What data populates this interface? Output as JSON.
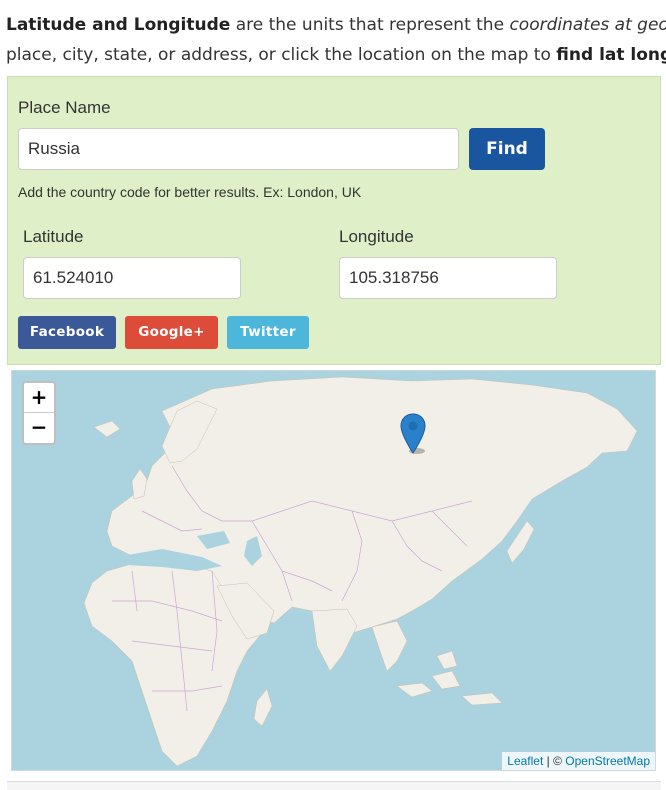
{
  "intro": {
    "line1_bold": "Latitude and Longitude",
    "line1_text": " are the units that represent the ",
    "line1_italic": "coordinates at geographic",
    "line2_text": "place, city, state, or address, or click the location on the map to ",
    "line2_bold": "find lat long coord"
  },
  "form": {
    "place_label": "Place Name",
    "place_value": "Russia",
    "find_label": "Find",
    "hint": "Add the country code for better results. Ex: London, UK",
    "latitude_label": "Latitude",
    "latitude_value": "61.524010",
    "longitude_label": "Longitude",
    "longitude_value": "105.318756"
  },
  "share": {
    "facebook": "Facebook",
    "google": "Google+",
    "twitter": "Twitter"
  },
  "map": {
    "zoom_in": "+",
    "zoom_out": "−",
    "attribution_leaflet": "Leaflet",
    "attribution_sep": " | © ",
    "attribution_osm": "OpenStreetMap",
    "marker_icon": "map-marker-icon",
    "colors": {
      "water": "#aad3df",
      "land": "#f2efe9",
      "border": "#c9a8d4",
      "marker": "#2a81cb"
    }
  }
}
